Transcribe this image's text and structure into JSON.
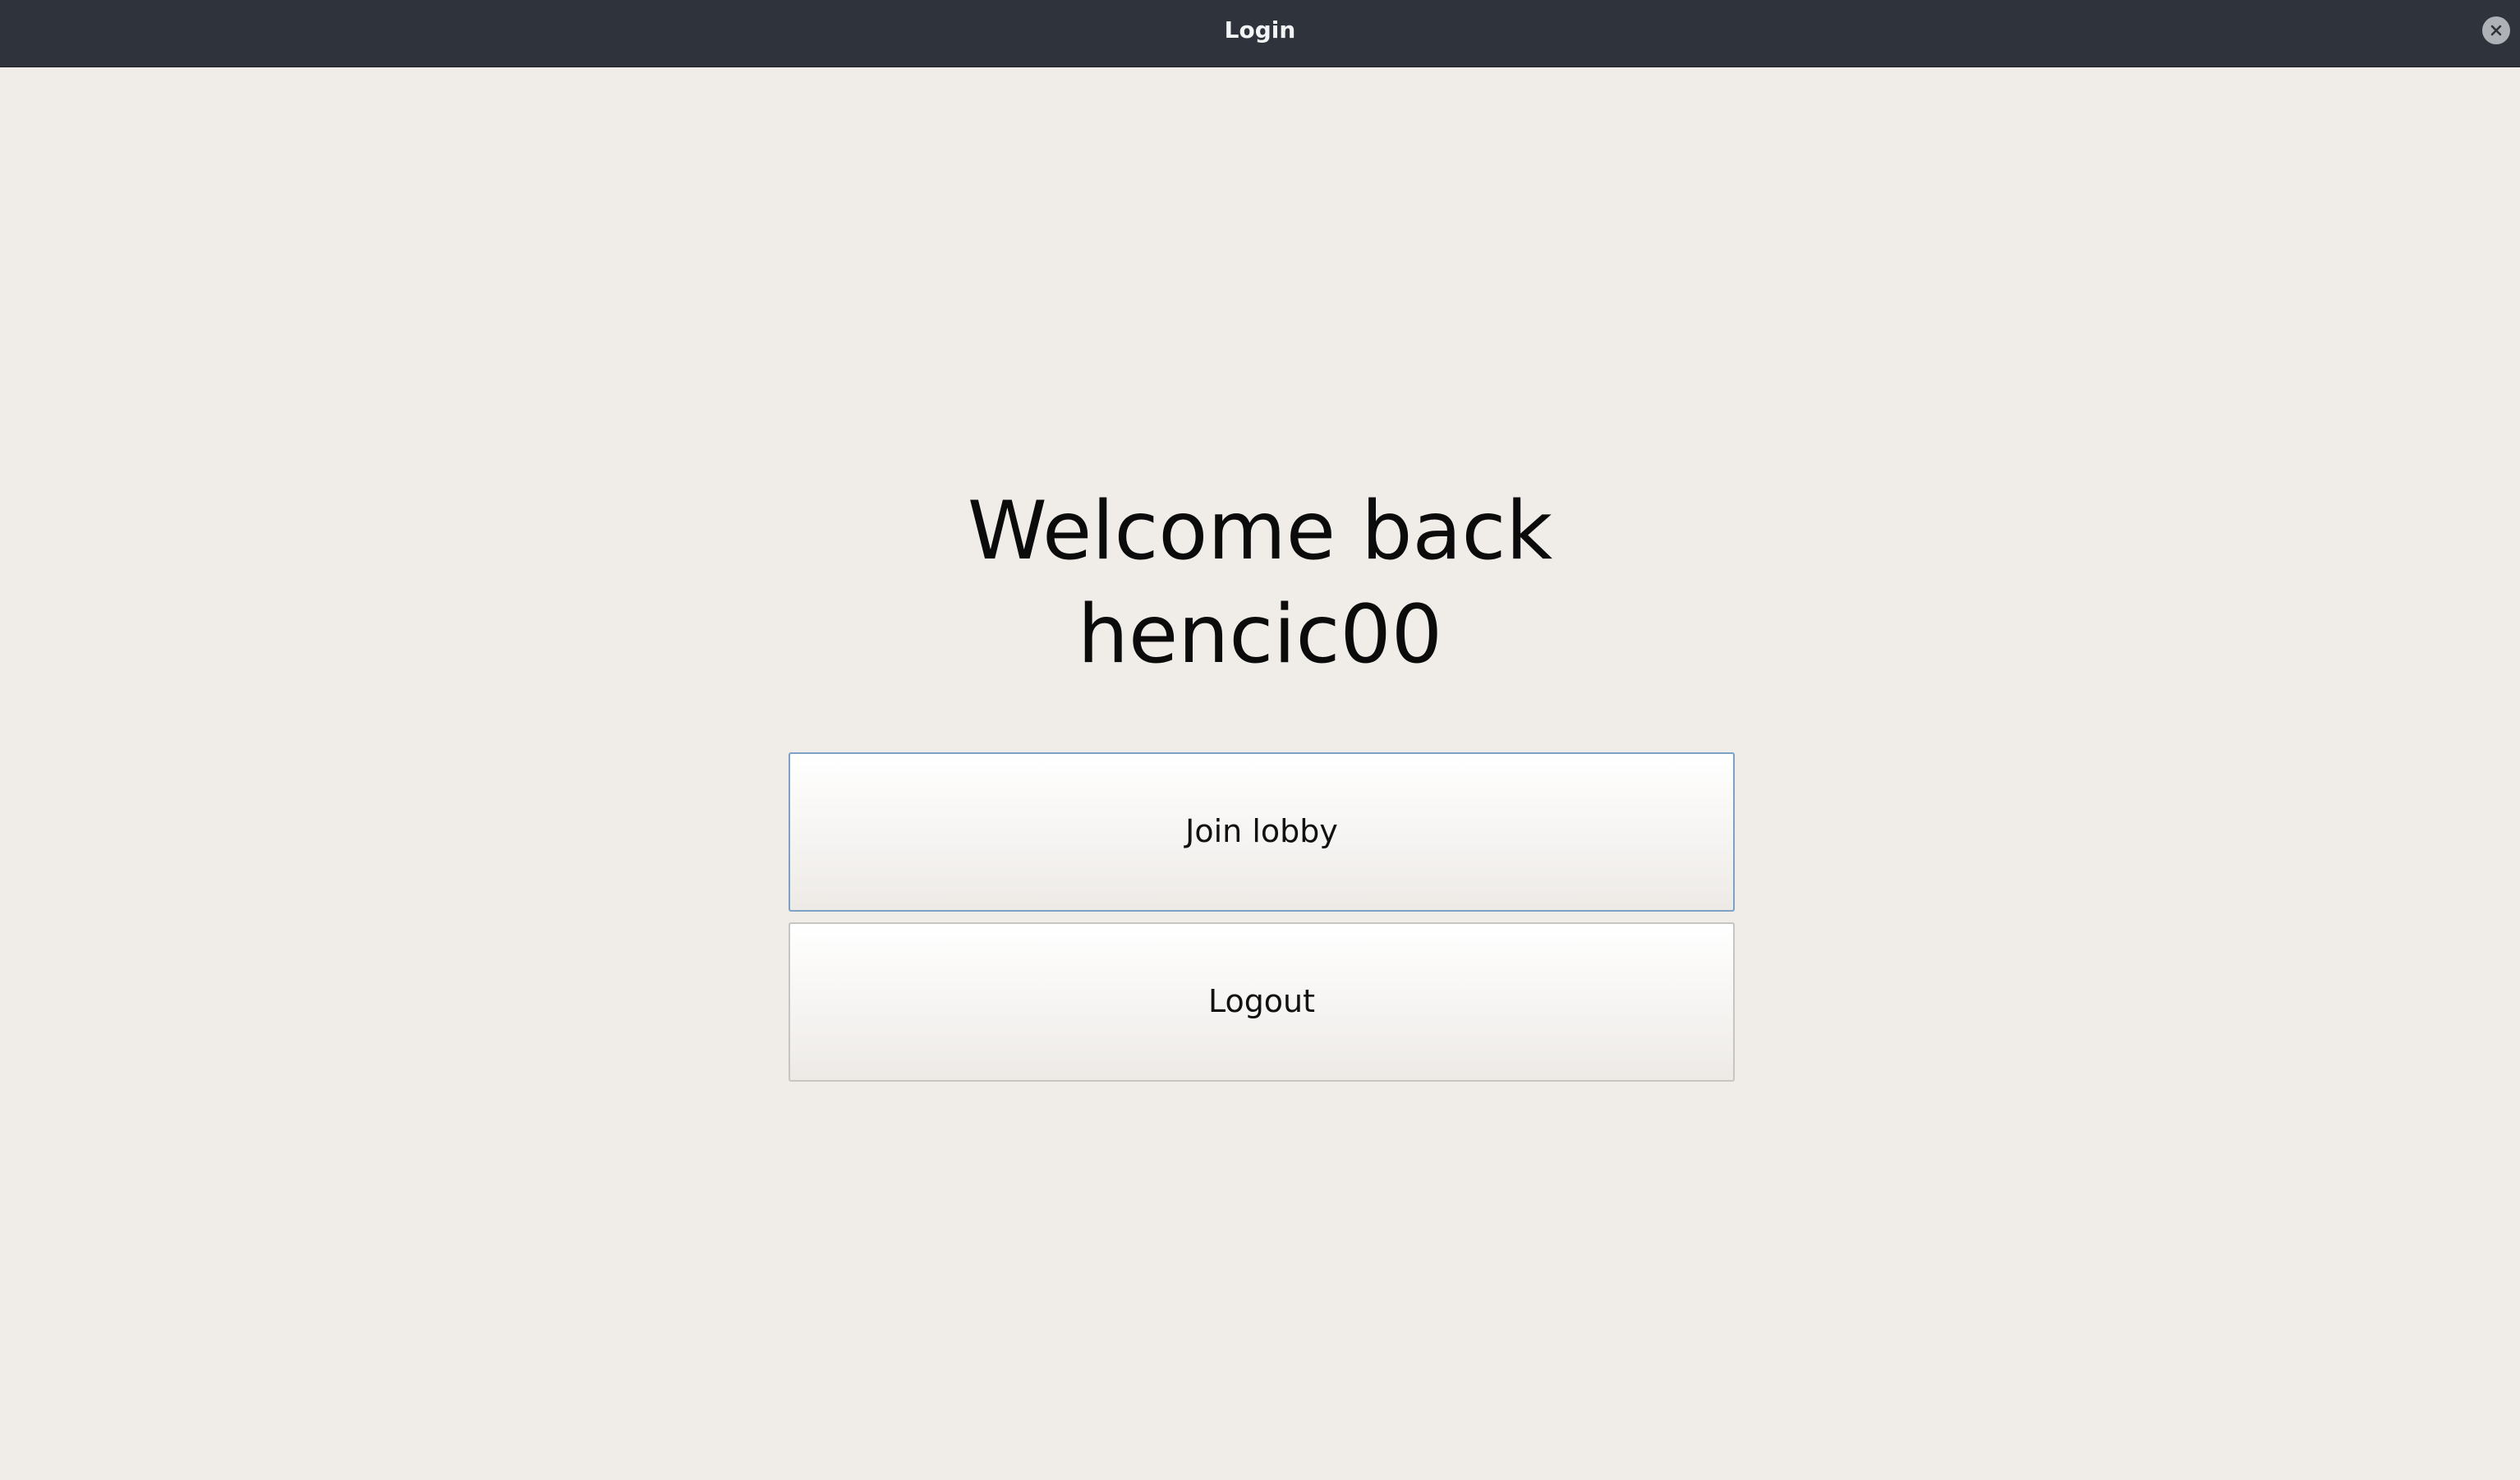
{
  "window": {
    "title": "Login"
  },
  "welcome": {
    "line1": "Welcome back",
    "username": "hencic00"
  },
  "actions": {
    "join_lobby_label": "Join lobby",
    "logout_label": "Logout"
  },
  "icons": {
    "close": "close-icon"
  },
  "colors": {
    "titlebar": "#2e333c",
    "background": "#f0ede9",
    "focus_border": "#7ea1c6"
  }
}
